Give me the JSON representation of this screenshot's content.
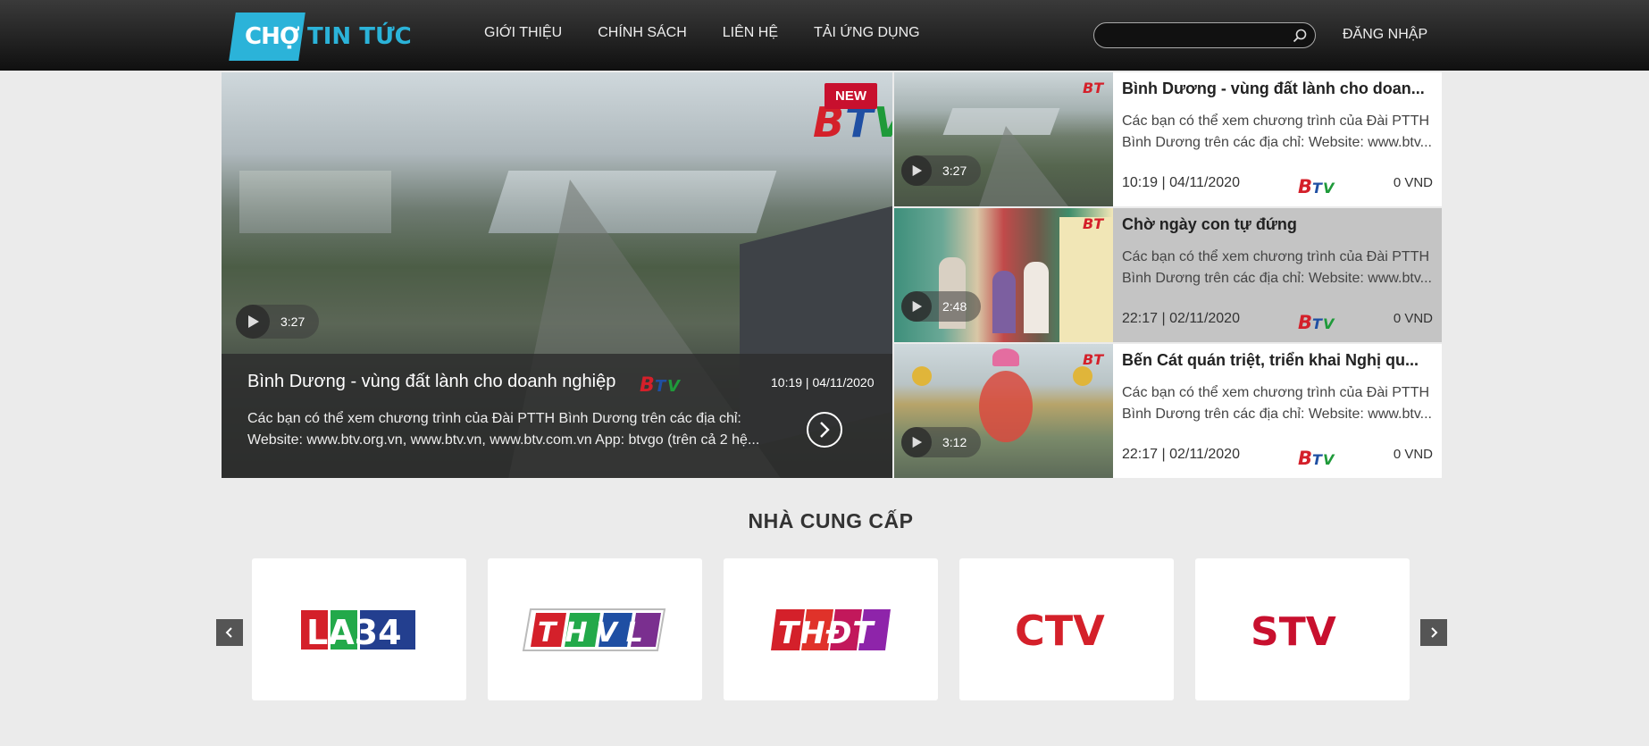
{
  "header": {
    "logo_text_cho": "CHỢ",
    "logo_text_rest": "TIN TỨC",
    "nav": [
      "GIỚI THIỆU",
      "CHÍNH SÁCH",
      "LIÊN HỆ",
      "TẢI ỨNG DỤNG"
    ],
    "search": {
      "placeholder": ""
    },
    "login": "ĐĂNG NHẬP"
  },
  "hero": {
    "badge": "NEW",
    "duration": "3:27",
    "title": "Bình Dương - vùng đất lành cho doanh nghiệp",
    "date": "10:19 | 04/11/2020",
    "description": "Các bạn có thể xem chương trình của Đài PTTH Bình Dương trên các địa chỉ: Website: www.btv.org.vn, www.btv.vn, www.btv.com.vn App: btvgo (trên cả 2 hệ..."
  },
  "side_items": [
    {
      "title": "Bình Dương - vùng đất lành cho doan...",
      "description": "Các bạn có thể xem chương trình của Đài PTTH Bình Dương trên các địa chỉ: Website: www.btv...",
      "duration": "3:27",
      "date": "10:19 | 04/11/2020",
      "price": "0 VND"
    },
    {
      "title": "Chờ ngày con tự đứng",
      "description": "Các bạn có thể xem chương trình của Đài PTTH Bình Dương trên các địa chỉ: Website: www.btv...",
      "duration": "2:48",
      "date": "22:17 | 02/11/2020",
      "price": "0 VND"
    },
    {
      "title": "Bến Cát quán triệt, triển khai Nghị qu...",
      "description": "Các bạn có thể xem chương trình của Đài PTTH Bình Dương trên các địa chỉ: Website: www.btv...",
      "duration": "3:12",
      "date": "22:17 | 02/11/2020",
      "price": "0 VND"
    }
  ],
  "providers": {
    "title": "NHÀ CUNG CẤP",
    "logos": [
      "LA34",
      "THVL",
      "THĐT",
      "CTV",
      "STV"
    ]
  },
  "colors": {
    "brand": "#2bb3d9",
    "badge": "#c8102e",
    "active_row": "#c4c4c4"
  }
}
